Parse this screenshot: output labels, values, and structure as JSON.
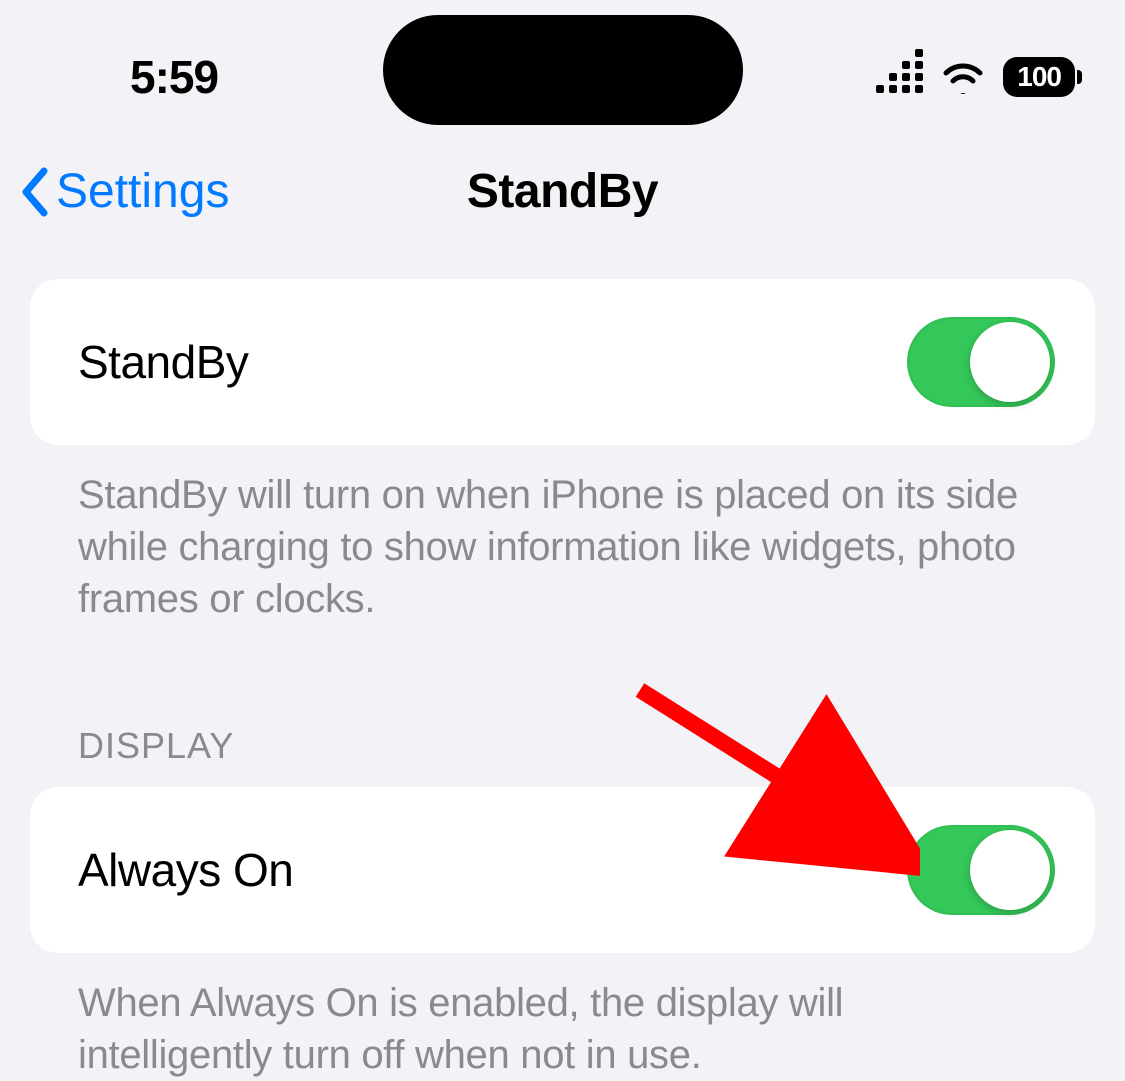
{
  "statusBar": {
    "time": "5:59",
    "batteryPercent": "100"
  },
  "nav": {
    "backLabel": "Settings",
    "title": "StandBy"
  },
  "settings": {
    "standby": {
      "label": "StandBy",
      "footer": "StandBy will turn on when iPhone is placed on its side while charging to show information like widgets, photo frames or clocks.",
      "enabled": true
    },
    "displaySection": {
      "header": "DISPLAY",
      "alwaysOn": {
        "label": "Always On",
        "footer": "When Always On is enabled, the display will intelligently turn off when not in use.",
        "enabled": true
      }
    }
  }
}
